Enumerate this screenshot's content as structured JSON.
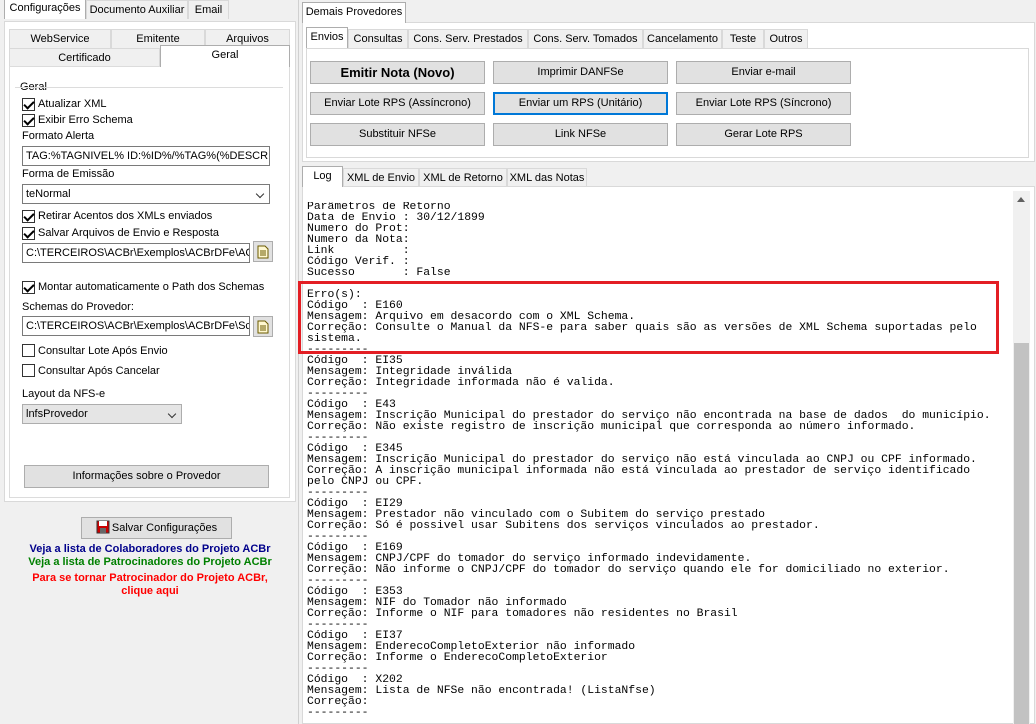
{
  "left": {
    "tabs": [
      "Configurações",
      "Documento Auxiliar",
      "Email"
    ],
    "subtabs_row1": [
      "WebService",
      "Emitente",
      "Arquivos"
    ],
    "subtabs_row2": [
      "Certificado",
      "Geral"
    ],
    "group_title": "Geral",
    "atualizar_xml": "Atualizar XML",
    "exibir_erro": "Exibir Erro Schema",
    "formato_alerta_label": "Formato Alerta",
    "formato_alerta_value": "TAG:%TAGNIVEL% ID:%ID%/%TAG%(%DESCRI",
    "forma_emissao_label": "Forma de Emissão",
    "forma_emissao_value": "teNormal",
    "retirar_acentos": "Retirar Acentos dos XMLs enviados",
    "salvar_arquivos": "Salvar Arquivos de Envio e Resposta",
    "path_arquivos": "C:\\TERCEIROS\\ACBr\\Exemplos\\ACBrDFe\\ACBr",
    "montar_path": "Montar automaticamente o Path dos Schemas",
    "schemas_label": "Schemas do Provedor:",
    "path_schemas": "C:\\TERCEIROS\\ACBr\\Exemplos\\ACBrDFe\\Sche",
    "consultar_lote": "Consultar Lote Após Envio",
    "consultar_cancelar": "Consultar Após Cancelar",
    "layout_label": "Layout da NFS-e",
    "layout_value": "lnfsProvedor",
    "info_provedor": "Informações sobre o Provedor",
    "salvar_config": "Salvar Configurações",
    "link_colab": "Veja a lista de Colaboradores do Projeto ACBr",
    "link_patroc": "Veja a lista de Patrocinadores do Projeto ACBr",
    "link_tornar1": "Para se tornar Patrocinador do Projeto ACBr,",
    "link_tornar2": "clique aqui",
    "colors": {
      "blue": "#00008b",
      "green": "#008000",
      "red": "#ff0000"
    }
  },
  "right": {
    "outer_tab": "Demais Provedores",
    "tabs": [
      "Envios",
      "Consultas",
      "Cons. Serv. Prestados",
      "Cons. Serv. Tomados",
      "Cancelamento",
      "Teste",
      "Outros"
    ],
    "buttons": {
      "emitir": "Emitir Nota (Novo)",
      "imprimir": "Imprimir DANFSe",
      "email": "Enviar e-mail",
      "lote_async": "Enviar Lote RPS (Assíncrono)",
      "um_rps": "Enviar um RPS (Unitário)",
      "lote_sync": "Enviar Lote RPS (Síncrono)",
      "substituir": "Substituir NFSe",
      "link": "Link NFSe",
      "gerar": "Gerar Lote RPS"
    },
    "log_tabs": [
      "Log",
      "XML de Envio",
      "XML de Retorno",
      "XML das Notas"
    ],
    "highlight_color": "#e31e24",
    "log_lines": [
      "Parâmetros de Retorno",
      "Data de Envio : 30/12/1899",
      "Numero do Prot:",
      "Numero da Nota:",
      "Link          :",
      "Código Verif. :",
      "Sucesso       : False",
      "",
      "Erro(s):",
      "Código  : E160",
      "Mensagem: Arquivo em desacordo com o XML Schema.",
      "Correção: Consulte o Manual da NFS-e para saber quais são as versões de XML Schema suportadas pelo",
      "sistema.",
      "---------",
      "Código  : EI35",
      "Mensagem: Integridade inválida",
      "Correção: Integridade informada não é valida.",
      "---------",
      "Código  : E43",
      "Mensagem: Inscrição Municipal do prestador do serviço não encontrada na base de dados  do município.",
      "Correção: Não existe registro de inscrição municipal que corresponda ao número informado.",
      "---------",
      "Código  : E345",
      "Mensagem: Inscrição Municipal do prestador do serviço não está vinculada ao CNPJ ou CPF informado.",
      "Correção: A inscrição municipal informada não está vinculada ao prestador de serviço identificado",
      "pelo CNPJ ou CPF.",
      "---------",
      "Código  : EI29",
      "Mensagem: Prestador não vinculado com o Subitem do serviço prestado",
      "Correção: Só é possivel usar Subitens dos serviços vinculados ao prestador.",
      "---------",
      "Código  : E169",
      "Mensagem: CNPJ/CPF do tomador do serviço informado indevidamente.",
      "Correção: Não informe o CNPJ/CPF do tomador do serviço quando ele for domiciliado no exterior.",
      "---------",
      "Código  : E353",
      "Mensagem: NIF do Tomador não informado",
      "Correção: Informe o NIF para tomadores não residentes no Brasil",
      "---------",
      "Código  : EI37",
      "Mensagem: EnderecoCompletoExterior não informado",
      "Correção: Informe o EnderecoCompletoExterior",
      "---------",
      "Código  : X202",
      "Mensagem: Lista de NFSe não encontrada! (ListaNfse)",
      "Correção:",
      "---------"
    ]
  }
}
